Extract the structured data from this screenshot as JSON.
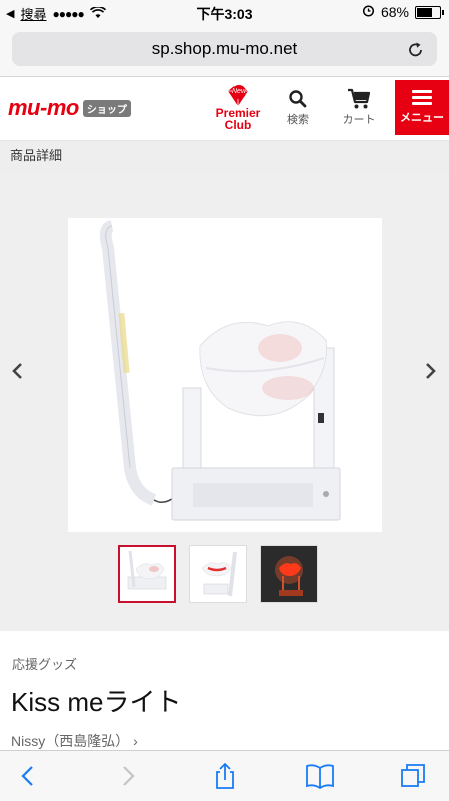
{
  "status": {
    "back_app": "搜尋",
    "signal": "●●●●●",
    "time": "下午3:03",
    "battery": "68%",
    "battery_level": 0.68
  },
  "browser": {
    "url": "sp.shop.mu-mo.net"
  },
  "header": {
    "logo": "mu-mo",
    "logo_badge": "ショップ",
    "premier_badge": "New",
    "premier_label_1": "Premier",
    "premier_label_2": "Club",
    "search_label": "検索",
    "cart_label": "カート",
    "menu_label": "メニュー"
  },
  "breadcrumb": "商品詳細",
  "product": {
    "category": "応援グッズ",
    "title": "Kiss meライト",
    "artist": "Nissy（西島隆弘）"
  },
  "colors": {
    "brand": "#e60012",
    "ios_blue": "#1a7cf5"
  }
}
